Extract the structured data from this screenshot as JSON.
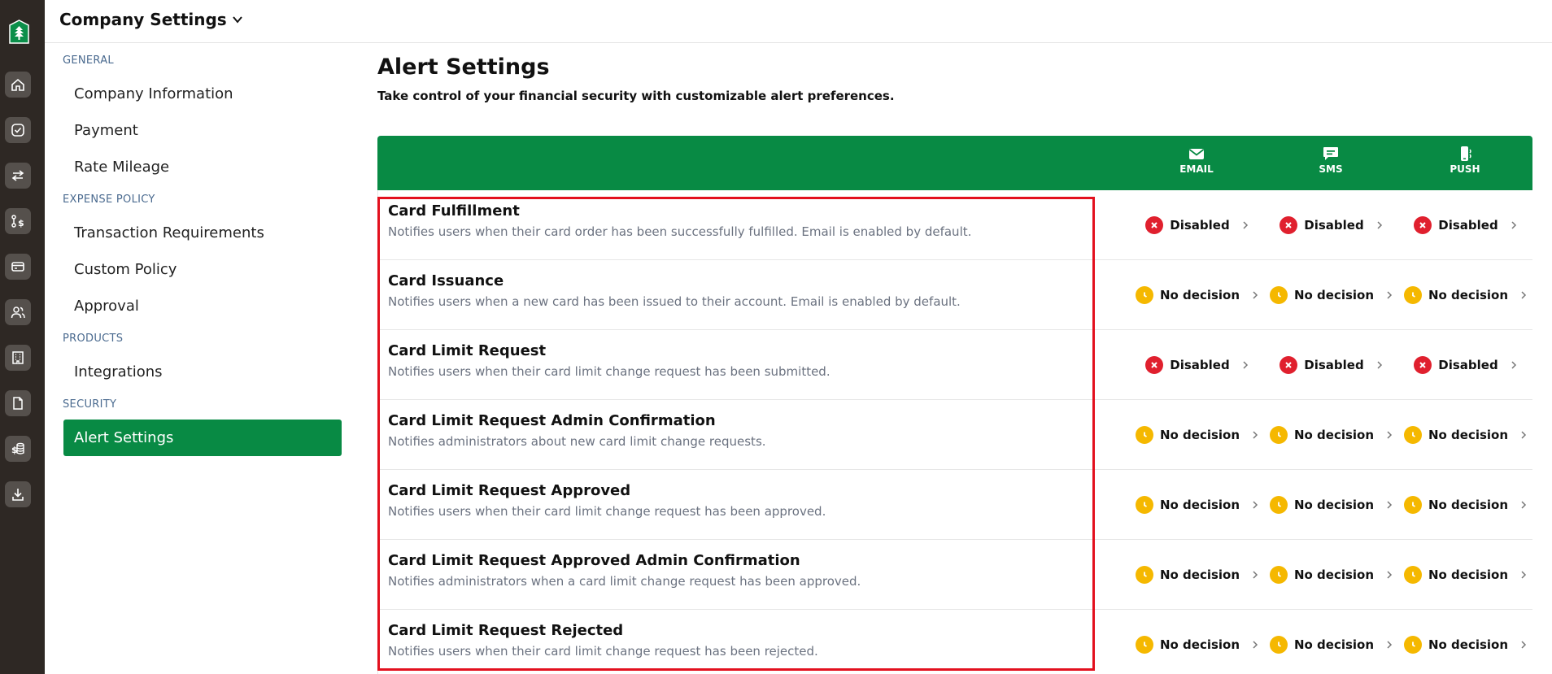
{
  "app": {
    "company_title": "Company Settings"
  },
  "rail": {
    "items": [
      {
        "icon": "home-icon"
      },
      {
        "icon": "check-circle-icon"
      },
      {
        "icon": "transfer-arrows-icon"
      },
      {
        "icon": "route-dollar-icon"
      },
      {
        "icon": "card-icon"
      },
      {
        "icon": "users-icon"
      },
      {
        "icon": "building-icon"
      },
      {
        "icon": "receipt-icon"
      },
      {
        "icon": "dollar-coins-icon"
      },
      {
        "icon": "download-icon"
      }
    ]
  },
  "nav": {
    "sections": [
      {
        "label": "GENERAL",
        "items": [
          "Company Information",
          "Payment",
          "Rate Mileage"
        ]
      },
      {
        "label": "EXPENSE POLICY",
        "items": [
          "Transaction Requirements",
          "Custom Policy",
          "Approval"
        ]
      },
      {
        "label": "PRODUCTS",
        "items": [
          "Integrations"
        ]
      },
      {
        "label": "SECURITY",
        "items": [
          "Alert Settings"
        ]
      }
    ],
    "active": "Alert Settings"
  },
  "page": {
    "title": "Alert Settings",
    "subtitle": "Take control of your financial security with customizable alert preferences."
  },
  "table": {
    "channels": [
      {
        "label": "EMAIL",
        "icon": "email-icon"
      },
      {
        "label": "SMS",
        "icon": "sms-icon"
      },
      {
        "label": "PUSH",
        "icon": "push-phone-icon"
      }
    ],
    "rows": [
      {
        "title": "Card Fulfillment",
        "desc": "Notifies users when their card order has been successfully fulfilled. Email is enabled by default.",
        "status": [
          "Disabled",
          "Disabled",
          "Disabled"
        ]
      },
      {
        "title": "Card Issuance",
        "desc": "Notifies users when a new card has been issued to their account. Email is enabled by default.",
        "status": [
          "No decision",
          "No decision",
          "No decision"
        ]
      },
      {
        "title": "Card Limit Request",
        "desc": "Notifies users when their card limit change request has been submitted.",
        "status": [
          "Disabled",
          "Disabled",
          "Disabled"
        ]
      },
      {
        "title": "Card Limit Request Admin Confirmation",
        "desc": "Notifies administrators about new card limit change requests.",
        "status": [
          "No decision",
          "No decision",
          "No decision"
        ]
      },
      {
        "title": "Card Limit Request Approved",
        "desc": "Notifies users when their card limit change request has been approved.",
        "status": [
          "No decision",
          "No decision",
          "No decision"
        ]
      },
      {
        "title": "Card Limit Request Approved Admin Confirmation",
        "desc": "Notifies administrators when a card limit change request has been approved.",
        "status": [
          "No decision",
          "No decision",
          "No decision"
        ]
      },
      {
        "title": "Card Limit Request Rejected",
        "desc": "Notifies users when their card limit change request has been rejected.",
        "status": [
          "No decision",
          "No decision",
          "No decision"
        ]
      }
    ]
  },
  "colors": {
    "brand_green": "#088a44",
    "rail_bg": "#2e2824",
    "disabled_red": "#e0202e",
    "pending_yellow": "#f5b800",
    "highlight_red": "#e3101e"
  }
}
